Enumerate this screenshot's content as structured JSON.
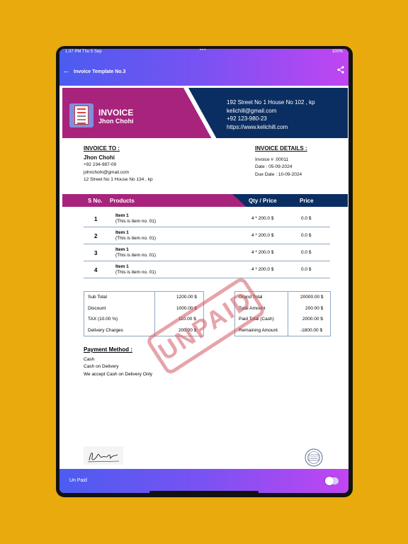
{
  "status": {
    "time": "1:37 PM  Thu 5 Sep",
    "dots": "•••",
    "battery": "100%"
  },
  "appbar": {
    "back_icon": "arrow-left-icon",
    "title": "Invoice Template No.3",
    "share_icon": "share-icon"
  },
  "invoice_header": {
    "word": "INVOICE",
    "name": "Jhon Chohi",
    "company_lines": [
      "192 Street No 1 House No 102 , kp",
      "kelichill@gmail.com",
      "+92 123-980-23",
      "https://www.kelichill.com"
    ],
    "colors": {
      "magenta": "#a8237c",
      "navy": "#0b2e62"
    }
  },
  "bill_to": {
    "heading": "INVOICE TO :",
    "name": "Jhon Chohi",
    "phone": "+92 234-987-09",
    "email": "johnchohi@gmail.com",
    "address": "12 Street No 1 House No 134 , kp"
  },
  "details": {
    "heading": "INVOICE DETAILS :",
    "number": "Invoice # :00011",
    "date": "Date : 05-09-2024",
    "due": "Due Date : 10-09-2024"
  },
  "table": {
    "headers": [
      "S No.",
      "Products",
      "Qty / Price",
      "Price"
    ],
    "rows": [
      {
        "no": "1",
        "name": "Item 1",
        "desc": "(This is item no. 01)",
        "qty": "4 * 200.0  $",
        "price": "0.0  $"
      },
      {
        "no": "2",
        "name": "Item 1",
        "desc": "(This is item no. 01)",
        "qty": "4 * 200.0  $",
        "price": "0.0  $"
      },
      {
        "no": "3",
        "name": "Item 1",
        "desc": "(This is item no. 01)",
        "qty": "4 * 200.0  $",
        "price": "0.0  $"
      },
      {
        "no": "4",
        "name": "Item 1",
        "desc": "(This is item no. 01)",
        "qty": "4 * 200.0  $",
        "price": "0.0  $"
      }
    ]
  },
  "summary_left": [
    {
      "label": "Sub Total",
      "value": "1200.00  $"
    },
    {
      "label": "Discount",
      "value": "1000.00  $"
    },
    {
      "label": "TAX (10.00 %)",
      "value": "110.00  $"
    },
    {
      "label": "Delivery Charges",
      "value": "200.00  $"
    }
  ],
  "summary_right": [
    {
      "label": "Grand Total",
      "value": "20000.00  $"
    },
    {
      "label": "Total Amount",
      "value": "200.00  $"
    },
    {
      "label": "Paid Total (Cash)",
      "value": "2000.00  $"
    },
    {
      "label": "Remaining Amount",
      "value": "-1800.00  $"
    }
  ],
  "payment": {
    "heading": "Payment Method :",
    "lines": [
      "Cash",
      "Cash on Delivery",
      "We accept Cash on Delivery Only"
    ]
  },
  "stamp": {
    "text": "UNPAID",
    "color": "#d25a64"
  },
  "bottombar": {
    "label": "Un Paid",
    "toggle_on": false
  },
  "accent": {
    "gradient_start": "#4b5cf0",
    "gradient_end": "#c145f2",
    "background": "#e8aa0c"
  }
}
